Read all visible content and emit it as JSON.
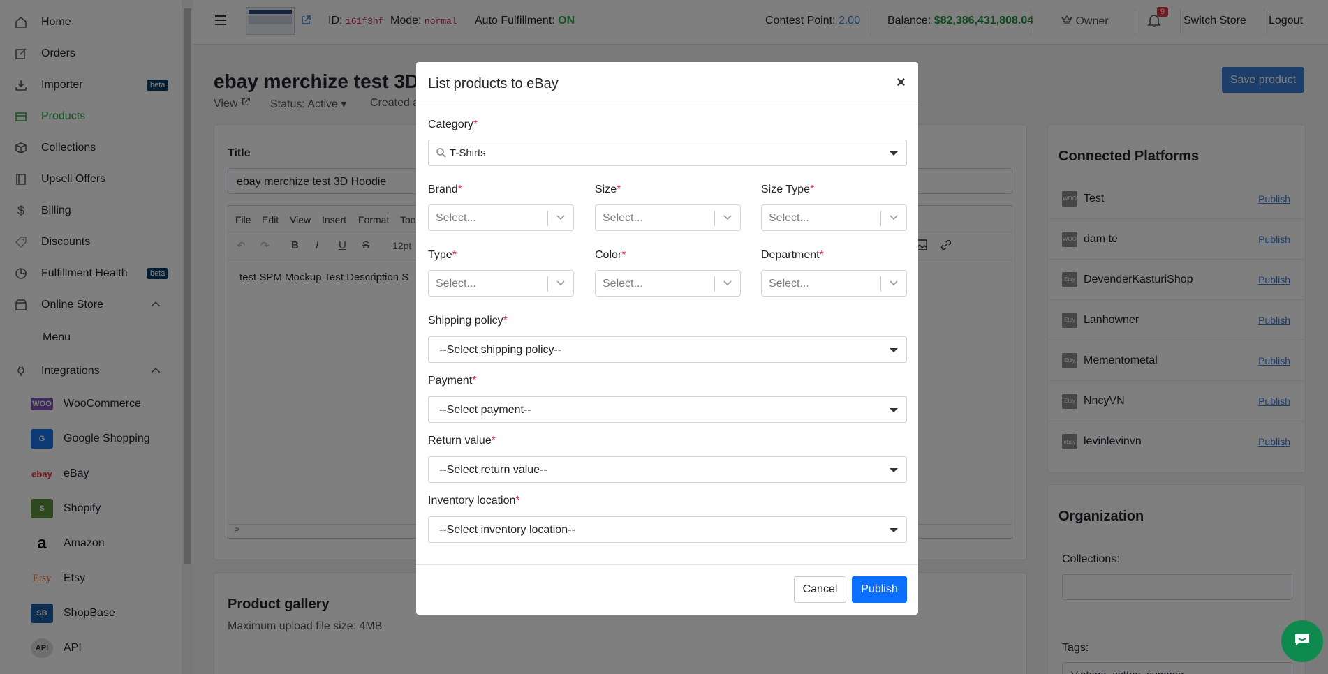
{
  "sidebar": {
    "items": [
      {
        "label": "Home",
        "icon": "home-icon"
      },
      {
        "label": "Orders",
        "icon": "edit-icon"
      },
      {
        "label": "Importer",
        "icon": "download-icon",
        "badge": "beta"
      },
      {
        "label": "Products",
        "icon": "product-icon",
        "active": true
      },
      {
        "label": "Collections",
        "icon": "box-icon"
      },
      {
        "label": "Upsell Offers",
        "icon": "book-icon"
      },
      {
        "label": "Billing",
        "icon": "dollar-icon"
      },
      {
        "label": "Discounts",
        "icon": "tag-icon"
      },
      {
        "label": "Fulfillment Health",
        "icon": "pie-icon",
        "badge": "beta"
      },
      {
        "label": "Online Store",
        "icon": "store-icon"
      }
    ],
    "online_store_sub": "Menu",
    "integrations_label": "Integrations",
    "integrations": [
      {
        "label": "WooCommerce",
        "logo": "WOO"
      },
      {
        "label": "Google Shopping",
        "logo": "G"
      },
      {
        "label": "eBay",
        "logo": "ebay"
      },
      {
        "label": "Shopify",
        "logo": "S"
      },
      {
        "label": "Amazon",
        "logo": "a"
      },
      {
        "label": "Etsy",
        "logo": "Etsy"
      },
      {
        "label": "ShopBase",
        "logo": "SB"
      },
      {
        "label": "API",
        "logo": "API"
      }
    ]
  },
  "topbar": {
    "id_label": "ID:",
    "id_value": "i61f3hf",
    "mode_label": "Mode:",
    "mode_value": "normal",
    "auto_label": "Auto Fulfillment:",
    "auto_value": "ON",
    "contest_label": "Contest Point:",
    "contest_value": "2.00",
    "balance_label": "Balance:",
    "balance_value": "$82,386,431,808.04",
    "owner": "Owner",
    "notif_count": "9",
    "switch_store": "Switch Store",
    "logout": "Logout"
  },
  "page": {
    "title": "ebay merchize test 3D",
    "view": "View",
    "status": "Status: Active",
    "created": "Created a",
    "save_button": "Save product",
    "title_label": "Title",
    "title_value": "ebay merchize test 3D Hoodie",
    "editor_menu": [
      "File",
      "Edit",
      "View",
      "Insert",
      "Format",
      "Tool"
    ],
    "font_size": "12pt",
    "editor_content": "test SPM Mockup Test Description S",
    "editor_status": "P",
    "gallery_title": "Product gallery",
    "gallery_note": "Maximum upload file size: 4MB"
  },
  "platforms": {
    "title": "Connected Platforms",
    "publish_label": "Publish",
    "items": [
      {
        "name": "Test",
        "logo": "WOO"
      },
      {
        "name": "dam te",
        "logo": "WOO"
      },
      {
        "name": "DevenderKasturiShop",
        "logo": "Etsy"
      },
      {
        "name": "Lanhowner",
        "logo": "Etsy"
      },
      {
        "name": "Mementometal",
        "logo": "Etsy"
      },
      {
        "name": "NncyVN",
        "logo": "Etsy"
      },
      {
        "name": "levinlevinvn",
        "logo": "ebay"
      }
    ]
  },
  "organization": {
    "title": "Organization",
    "collections_label": "Collections:",
    "tags_label": "Tags:",
    "tags_value": "Vintage, cotton, summer"
  },
  "modal": {
    "title": "List products to eBay",
    "close": "×",
    "category_label": "Category",
    "category_value": "T-Shirts",
    "required_mark": "*",
    "brand_label": "Brand",
    "size_label": "Size",
    "size_type_label": "Size Type",
    "type_label": "Type",
    "color_label": "Color",
    "department_label": "Department",
    "select_placeholder": "Select...",
    "shipping_label": "Shipping policy",
    "shipping_value": "--Select shipping policy--",
    "payment_label": "Payment",
    "payment_value": "--Select payment--",
    "return_label": "Return value",
    "return_value": "--Select return value--",
    "inventory_label": "Inventory location",
    "inventory_value": "--Select inventory location--",
    "cancel": "Cancel",
    "publish": "Publish"
  },
  "colors": {
    "active_green": "#28a745",
    "publish_blue": "#0b6fff",
    "badge_navy": "#0d3d63",
    "balance_green": "#1e8e3e"
  }
}
